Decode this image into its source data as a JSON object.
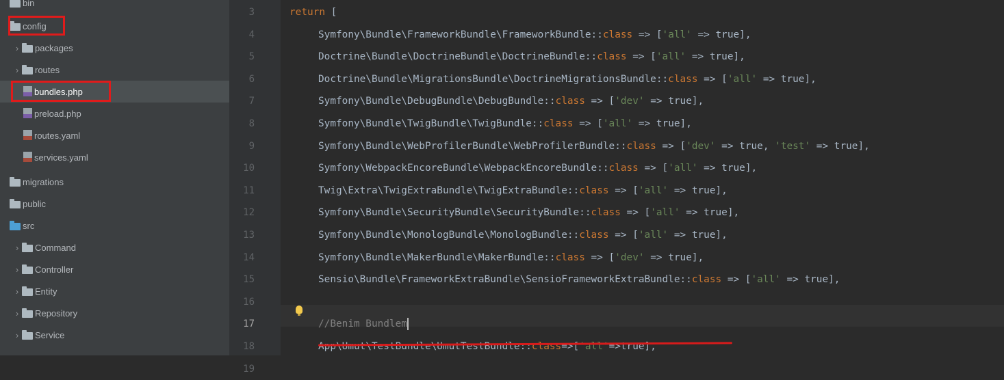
{
  "sidebar": {
    "items": [
      {
        "label": "bin",
        "type": "folder"
      },
      {
        "label": "config",
        "type": "folder"
      },
      {
        "label": "packages",
        "type": "folder"
      },
      {
        "label": "routes",
        "type": "folder"
      },
      {
        "label": "bundles.php",
        "type": "php-file"
      },
      {
        "label": "preload.php",
        "type": "php-file"
      },
      {
        "label": "routes.yaml",
        "type": "yaml-file"
      },
      {
        "label": "services.yaml",
        "type": "yaml-file"
      },
      {
        "label": "migrations",
        "type": "folder"
      },
      {
        "label": "public",
        "type": "folder"
      },
      {
        "label": "src",
        "type": "folder"
      },
      {
        "label": "Command",
        "type": "folder"
      },
      {
        "label": "Controller",
        "type": "folder"
      },
      {
        "label": "Entity",
        "type": "folder"
      },
      {
        "label": "Repository",
        "type": "folder"
      },
      {
        "label": "Service",
        "type": "folder"
      }
    ]
  },
  "gutter": {
    "line_numbers": [
      "3",
      "4",
      "5",
      "6",
      "7",
      "8",
      "9",
      "10",
      "11",
      "12",
      "13",
      "14",
      "15",
      "16",
      "17",
      "18",
      "19"
    ]
  },
  "editor": {
    "lines": [
      {
        "cls": "",
        "text": "Symfony\\Bundle\\FrameworkBundle\\FrameworkBundle::",
        "kw": "class",
        "mid": " => [",
        "str1": "'all'",
        "rest": " => true],"
      },
      {
        "cls": "",
        "text": "Doctrine\\Bundle\\DoctrineBundle\\DoctrineBundle::",
        "kw": "class",
        "mid": " => [",
        "str1": "'all'",
        "rest": " => true],"
      },
      {
        "cls": "",
        "text": "Doctrine\\Bundle\\MigrationsBundle\\DoctrineMigrationsBundle::",
        "kw": "class",
        "mid": " => [",
        "str1": "'all'",
        "rest": " => true],"
      },
      {
        "cls": "",
        "text": "Symfony\\Bundle\\DebugBundle\\DebugBundle::",
        "kw": "class",
        "mid": " => [",
        "str1": "'dev'",
        "rest": " => true],"
      },
      {
        "cls": "",
        "text": "Symfony\\Bundle\\TwigBundle\\TwigBundle::",
        "kw": "class",
        "mid": " => [",
        "str1": "'all'",
        "rest": " => true],"
      },
      {
        "cls": "",
        "text": "Symfony\\Bundle\\WebProfilerBundle\\WebProfilerBundle::",
        "kw": "class",
        "mid": " => [",
        "str1": "'dev'",
        "rest": " => true, ",
        "str2": "'test'",
        "rest2": " => true],"
      },
      {
        "cls": "",
        "text": "Symfony\\WebpackEncoreBundle\\WebpackEncoreBundle::",
        "kw": "class",
        "mid": " => [",
        "str1": "'all'",
        "rest": " => true],"
      },
      {
        "cls": "",
        "text": "Twig\\Extra\\TwigExtraBundle\\TwigExtraBundle::",
        "kw": "class",
        "mid": " => [",
        "str1": "'all'",
        "rest": " => true],"
      },
      {
        "cls": "",
        "text": "Symfony\\Bundle\\SecurityBundle\\SecurityBundle::",
        "kw": "class",
        "mid": " => [",
        "str1": "'all'",
        "rest": " => true],"
      },
      {
        "cls": "",
        "text": "Symfony\\Bundle\\MonologBundle\\MonologBundle::",
        "kw": "class",
        "mid": " => [",
        "str1": "'all'",
        "rest": " => true],"
      },
      {
        "cls": "",
        "text": "Symfony\\Bundle\\MakerBundle\\MakerBundle::",
        "kw": "class",
        "mid": " => [",
        "str1": "'dev'",
        "rest": " => true],"
      },
      {
        "cls": "",
        "text": "Sensio\\Bundle\\FrameworkExtraBundle\\SensioFrameworkExtraBundle::",
        "kw": "class",
        "mid": " => [",
        "str1": "'all'",
        "rest": " => true],"
      },
      {
        "cls": "",
        "text": "App\\Umut\\TestBundle\\UmutTestBundle::",
        "kw": "class",
        "mid": "=>[",
        "str1": "'all'",
        "rest": "=>true],"
      }
    ],
    "return_kw": "return",
    "return_rest": " [",
    "comment": "//Benim Bundlem",
    "closing": "];"
  },
  "colors": {
    "keyword": "#cc7832",
    "string": "#6a8759",
    "annotation_red": "#e01b1b"
  }
}
